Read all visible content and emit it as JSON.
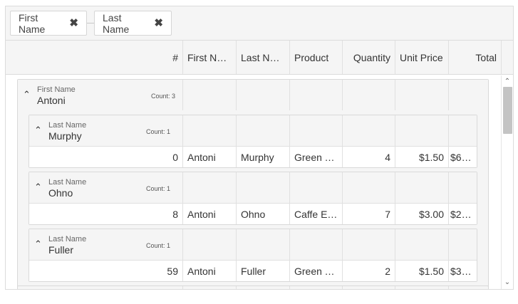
{
  "group_panel": {
    "chips": [
      {
        "label": "First Name",
        "remove_icon": "close-icon"
      },
      {
        "label": "Last Name",
        "remove_icon": "close-icon"
      }
    ]
  },
  "columns": [
    "#",
    "First Na…",
    "Last Na…",
    "Product",
    "Quantity",
    "Unit Price",
    "Total"
  ],
  "top_group": {
    "field": "First Name",
    "value": "Antoni",
    "count": "Count: 3"
  },
  "sub_groups": [
    {
      "field": "Last Name",
      "value": "Murphy",
      "count": "Count: 1",
      "row": [
        "0",
        "Antoni",
        "Murphy",
        "Green Tea",
        "4",
        "$1.50",
        "$6…"
      ]
    },
    {
      "field": "Last Name",
      "value": "Ohno",
      "count": "Count: 1",
      "row": [
        "8",
        "Antoni",
        "Ohno",
        "Caffe E…",
        "7",
        "$3.00",
        "$2…"
      ]
    },
    {
      "field": "Last Name",
      "value": "Fuller",
      "count": "Count: 1",
      "row": [
        "59",
        "Antoni",
        "Fuller",
        "Green Tea",
        "2",
        "$1.50",
        "$3…"
      ]
    }
  ],
  "icons": {
    "collapse": "chevron-up-icon",
    "scroll_up": "scroll-up-icon",
    "scroll_down": "scroll-down-icon"
  }
}
